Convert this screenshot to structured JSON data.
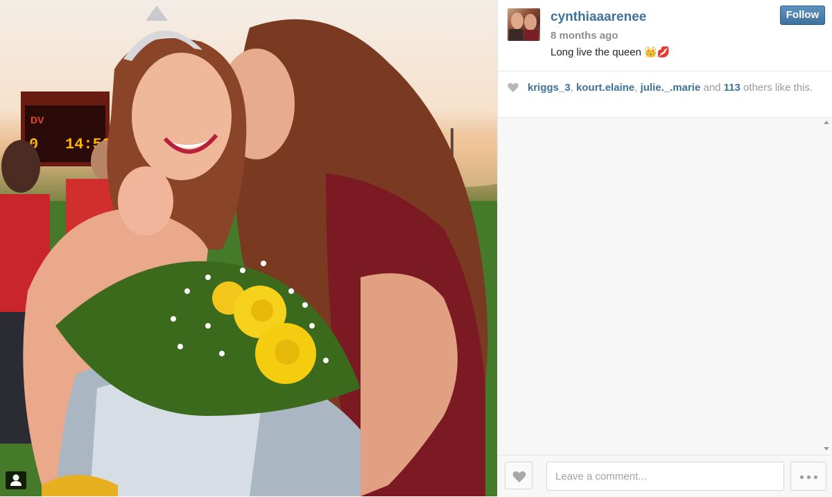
{
  "post": {
    "username": "cynthiaaarenee",
    "time_ago": "8 months ago",
    "caption": "Long live the queen 👑💋",
    "follow_label": "Follow"
  },
  "photo": {
    "scoreboard_home_score": "0",
    "scoreboard_clock": "14:56"
  },
  "likes": {
    "users": [
      "kriggs_3",
      "kourt.elaine",
      "julie._.marie"
    ],
    "sep1": ", ",
    "sep2": ", ",
    "and_text": " and ",
    "others_count": "113",
    "others_text": " others like this."
  },
  "comment": {
    "placeholder": "Leave a comment..."
  },
  "colors": {
    "link": "#3f729b",
    "follow_bg": "#3f729b"
  },
  "icons": {
    "like": "heart-icon",
    "more": "ellipsis-icon",
    "user_tag": "person-icon"
  }
}
